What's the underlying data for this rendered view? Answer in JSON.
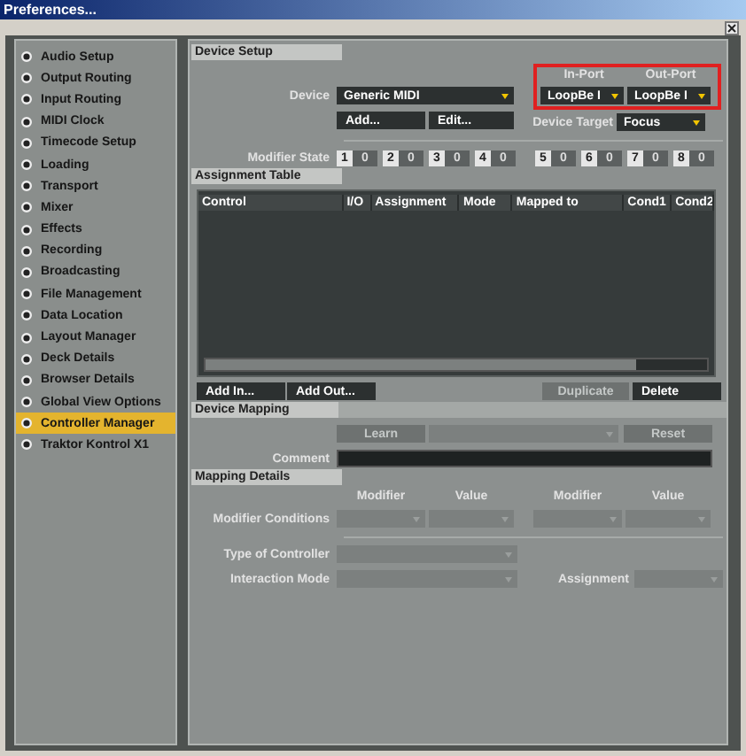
{
  "window": {
    "title": "Preferences..."
  },
  "sidebar": {
    "items": [
      {
        "label": "Audio Setup",
        "selected": false
      },
      {
        "label": "Output Routing",
        "selected": false
      },
      {
        "label": "Input Routing",
        "selected": false
      },
      {
        "label": "MIDI Clock",
        "selected": false
      },
      {
        "label": "Timecode Setup",
        "selected": false
      },
      {
        "label": "Loading",
        "selected": false
      },
      {
        "label": "Transport",
        "selected": false
      },
      {
        "label": "Mixer",
        "selected": false
      },
      {
        "label": "Effects",
        "selected": false
      },
      {
        "label": "Recording",
        "selected": false
      },
      {
        "label": "Broadcasting",
        "selected": false
      },
      {
        "label": "File Management",
        "selected": false
      },
      {
        "label": "Data Location",
        "selected": false
      },
      {
        "label": "Layout Manager",
        "selected": false
      },
      {
        "label": "Deck Details",
        "selected": false
      },
      {
        "label": "Browser Details",
        "selected": false
      },
      {
        "label": "Global View Options",
        "selected": false
      },
      {
        "label": "Controller Manager",
        "selected": true
      },
      {
        "label": "Traktor Kontrol X1",
        "selected": false
      }
    ]
  },
  "device_setup": {
    "title": "Device Setup",
    "ports_highlighted": true,
    "device": {
      "label": "Device",
      "value": "Generic MIDI"
    },
    "in_port": {
      "label": "In-Port",
      "value": "LoopBe I"
    },
    "out_port": {
      "label": "Out-Port",
      "value": "LoopBe I"
    },
    "buttons": [
      {
        "label": "Add...",
        "disabled": false
      },
      {
        "label": "Edit...",
        "disabled": false
      }
    ],
    "device_target": {
      "label": "Device Target",
      "value": "Focus"
    },
    "modifier_state": {
      "label": "Modifier State",
      "modifiers": [
        {
          "number": "1",
          "value": "0"
        },
        {
          "number": "2",
          "value": "0"
        },
        {
          "number": "3",
          "value": "0"
        },
        {
          "number": "4",
          "value": "0"
        },
        {
          "number": "5",
          "value": "0"
        },
        {
          "number": "6",
          "value": "0"
        },
        {
          "number": "7",
          "value": "0"
        },
        {
          "number": "8",
          "value": "0"
        }
      ]
    }
  },
  "assignment_table": {
    "title": "Assignment Table",
    "columns": [
      "Control",
      "I/O",
      "Assignment",
      "Mode",
      "Mapped to",
      "Cond1",
      "Cond2"
    ],
    "add_buttons": [
      {
        "label": "Add In...",
        "disabled": false
      },
      {
        "label": "Add Out...",
        "disabled": false
      }
    ],
    "actions": [
      {
        "label": "Duplicate",
        "disabled": true
      },
      {
        "label": "Delete",
        "disabled": false
      }
    ]
  },
  "device_mapping": {
    "title": "Device Mapping",
    "learn": {
      "label": "Learn",
      "disabled": true
    },
    "reset": {
      "label": "Reset",
      "disabled": true
    },
    "comment_label": "Comment"
  },
  "mapping_details": {
    "title": "Mapping Details",
    "condition_headers": [
      "Modifier",
      "Value",
      "Modifier",
      "Value"
    ],
    "modifier_conditions_label": "Modifier Conditions",
    "type_of_controller_label": "Type of Controller",
    "interaction_mode_label": "Interaction Mode",
    "assignment_label": "Assignment"
  }
}
